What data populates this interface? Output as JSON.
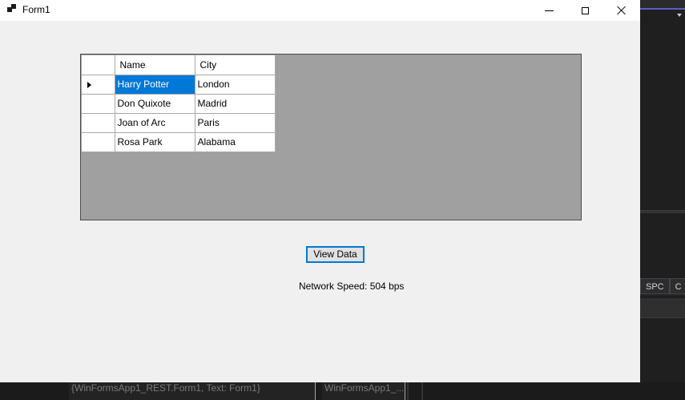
{
  "window": {
    "title": "Form1",
    "controls": [
      "minimize",
      "maximize",
      "close"
    ]
  },
  "grid": {
    "columns": [
      "Name",
      "City"
    ],
    "rows": [
      {
        "name": "Harry Potter",
        "city": "London",
        "selected_cell": "name",
        "current": true
      },
      {
        "name": "Don Quixote",
        "city": "Madrid"
      },
      {
        "name": "Joan of Arc",
        "city": "Paris"
      },
      {
        "name": "Rosa Park",
        "city": "Alabama"
      }
    ],
    "selection_color": "#0078d7"
  },
  "view_button": {
    "label": "View Data"
  },
  "status": {
    "network_speed": "Network Speed: 504 bps"
  },
  "ide_background": {
    "bottom_cells": [
      "{WinFormsApp1_REST.Form1, Text: Form1}",
      "WinFormsApp1_..."
    ],
    "tabs": [
      "SPC",
      "C"
    ]
  }
}
